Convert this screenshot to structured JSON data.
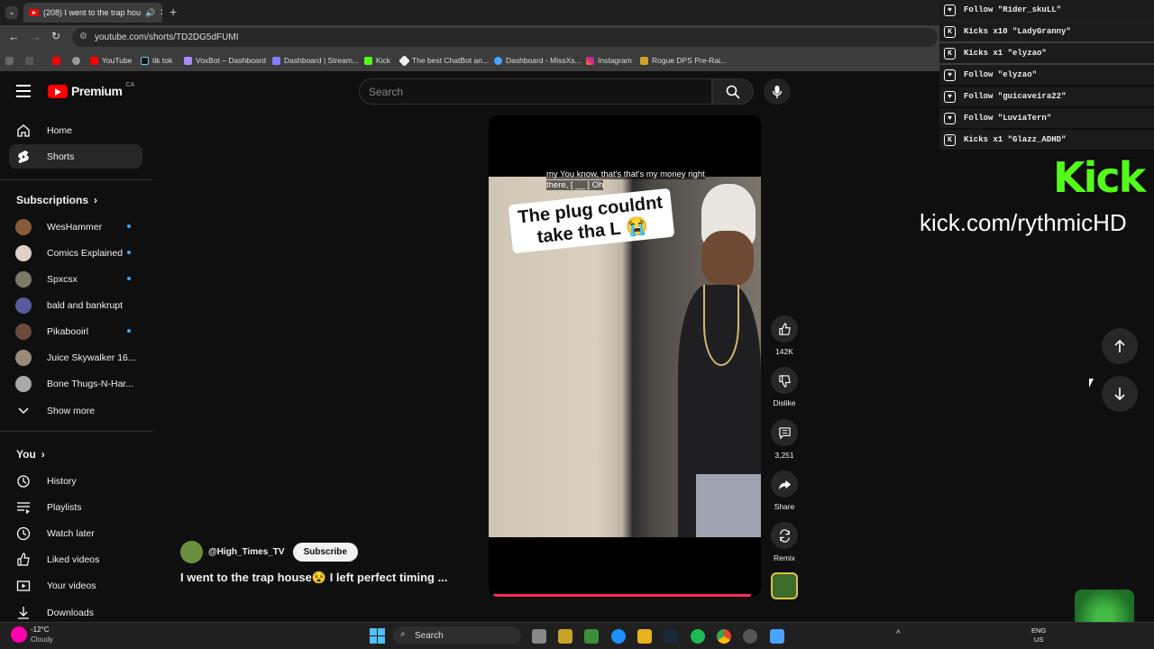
{
  "browser": {
    "tab_title": "(208) I went to the trap hou",
    "url": "youtube.com/shorts/TD2DG5dFUMI",
    "bookmarks": [
      "YouTube",
      "tik tok",
      "VoxBot – Dashboard",
      "Dashboard | Stream...",
      "Kick",
      "The best ChatBot an...",
      "Dashboard - MissXs...",
      "Instagram",
      "Rogue DPS Pre-Rai..."
    ]
  },
  "youtube": {
    "logo_text": "Premium",
    "region": "CA",
    "search_placeholder": "Search",
    "nav": {
      "home": "Home",
      "shorts": "Shorts"
    },
    "subscriptions_label": "Subscriptions",
    "subscriptions": [
      {
        "name": "WesHammer",
        "color": "#8a5a3a",
        "dot": true
      },
      {
        "name": "Comics Explained",
        "color": "#e0d0c8",
        "dot": true
      },
      {
        "name": "Spxcsx",
        "color": "#7a7a6a",
        "dot": true
      },
      {
        "name": "bald and bankrupt",
        "color": "#5a5aa0",
        "dot": false
      },
      {
        "name": "Pikabooirl",
        "color": "#6a4a3a",
        "dot": true
      },
      {
        "name": "Juice Skywalker 16...",
        "color": "#9a8a7a",
        "dot": false
      },
      {
        "name": "Bone Thugs-N-Har...",
        "color": "#aaaaaa",
        "dot": false
      }
    ],
    "show_more": "Show more",
    "you_label": "You",
    "you_items": [
      "History",
      "Playlists",
      "Watch later",
      "Liked videos",
      "Your videos",
      "Downloads"
    ]
  },
  "short": {
    "caption": "my You know, that's that's my money right there, [ __ ] Oh",
    "overlay_text": "The plug couldnt take tha L 😭",
    "channel": "@High_Times_TV",
    "subscribe_label": "Subscribe",
    "title": "I went to the trap house😵 I left perfect timing ...",
    "likes": "142K",
    "dislike_label": "Dislike",
    "comments": "3,251",
    "share_label": "Share",
    "remix_label": "Remix",
    "progress": 0.98
  },
  "stream_overlay": {
    "alerts": [
      {
        "icon": "heart",
        "text": "Follow \"Rider_skuLL\""
      },
      {
        "icon": "kick",
        "text": "Kicks x10 \"LadyGranny\""
      },
      {
        "icon": "kick",
        "text": "Kicks x1 \"elyzao\""
      },
      {
        "icon": "heart",
        "text": "Follow \"elyzao\""
      },
      {
        "icon": "heart",
        "text": "Follow \"guicaveira22\""
      },
      {
        "icon": "heart",
        "text": "Follow \"LuviaTern\""
      },
      {
        "icon": "kick",
        "text": "Kicks x1 \"Glazz_ADHD\""
      }
    ],
    "kick_logo": "Kick",
    "kick_url": "kick.com/rythmicHD",
    "accent": "#53fc18"
  },
  "taskbar": {
    "weather_temp": "-12°C",
    "weather_desc": "Cloudy",
    "search_label": "Search",
    "lang": "ENG",
    "region": "US"
  }
}
